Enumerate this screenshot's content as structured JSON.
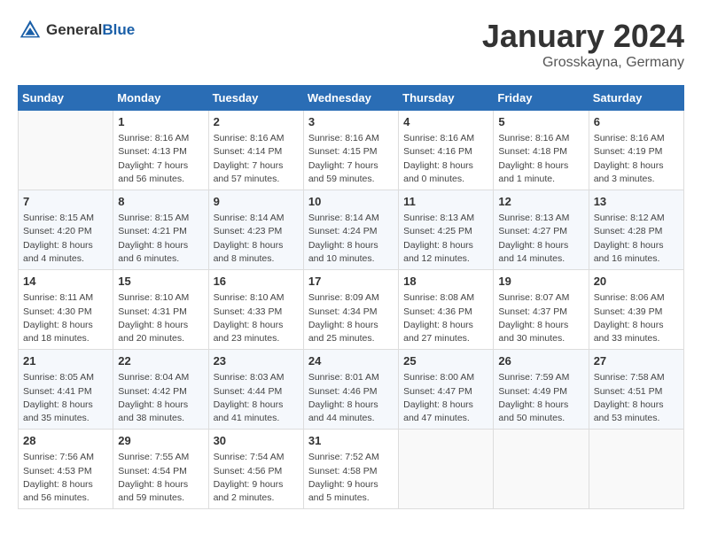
{
  "header": {
    "logo_general": "General",
    "logo_blue": "Blue",
    "month": "January 2024",
    "location": "Grosskayna, Germany"
  },
  "weekdays": [
    "Sunday",
    "Monday",
    "Tuesday",
    "Wednesday",
    "Thursday",
    "Friday",
    "Saturday"
  ],
  "weeks": [
    [
      {
        "day": "",
        "info": ""
      },
      {
        "day": "1",
        "info": "Sunrise: 8:16 AM\nSunset: 4:13 PM\nDaylight: 7 hours\nand 56 minutes."
      },
      {
        "day": "2",
        "info": "Sunrise: 8:16 AM\nSunset: 4:14 PM\nDaylight: 7 hours\nand 57 minutes."
      },
      {
        "day": "3",
        "info": "Sunrise: 8:16 AM\nSunset: 4:15 PM\nDaylight: 7 hours\nand 59 minutes."
      },
      {
        "day": "4",
        "info": "Sunrise: 8:16 AM\nSunset: 4:16 PM\nDaylight: 8 hours\nand 0 minutes."
      },
      {
        "day": "5",
        "info": "Sunrise: 8:16 AM\nSunset: 4:18 PM\nDaylight: 8 hours\nand 1 minute."
      },
      {
        "day": "6",
        "info": "Sunrise: 8:16 AM\nSunset: 4:19 PM\nDaylight: 8 hours\nand 3 minutes."
      }
    ],
    [
      {
        "day": "7",
        "info": "Sunrise: 8:15 AM\nSunset: 4:20 PM\nDaylight: 8 hours\nand 4 minutes."
      },
      {
        "day": "8",
        "info": "Sunrise: 8:15 AM\nSunset: 4:21 PM\nDaylight: 8 hours\nand 6 minutes."
      },
      {
        "day": "9",
        "info": "Sunrise: 8:14 AM\nSunset: 4:23 PM\nDaylight: 8 hours\nand 8 minutes."
      },
      {
        "day": "10",
        "info": "Sunrise: 8:14 AM\nSunset: 4:24 PM\nDaylight: 8 hours\nand 10 minutes."
      },
      {
        "day": "11",
        "info": "Sunrise: 8:13 AM\nSunset: 4:25 PM\nDaylight: 8 hours\nand 12 minutes."
      },
      {
        "day": "12",
        "info": "Sunrise: 8:13 AM\nSunset: 4:27 PM\nDaylight: 8 hours\nand 14 minutes."
      },
      {
        "day": "13",
        "info": "Sunrise: 8:12 AM\nSunset: 4:28 PM\nDaylight: 8 hours\nand 16 minutes."
      }
    ],
    [
      {
        "day": "14",
        "info": "Sunrise: 8:11 AM\nSunset: 4:30 PM\nDaylight: 8 hours\nand 18 minutes."
      },
      {
        "day": "15",
        "info": "Sunrise: 8:10 AM\nSunset: 4:31 PM\nDaylight: 8 hours\nand 20 minutes."
      },
      {
        "day": "16",
        "info": "Sunrise: 8:10 AM\nSunset: 4:33 PM\nDaylight: 8 hours\nand 23 minutes."
      },
      {
        "day": "17",
        "info": "Sunrise: 8:09 AM\nSunset: 4:34 PM\nDaylight: 8 hours\nand 25 minutes."
      },
      {
        "day": "18",
        "info": "Sunrise: 8:08 AM\nSunset: 4:36 PM\nDaylight: 8 hours\nand 27 minutes."
      },
      {
        "day": "19",
        "info": "Sunrise: 8:07 AM\nSunset: 4:37 PM\nDaylight: 8 hours\nand 30 minutes."
      },
      {
        "day": "20",
        "info": "Sunrise: 8:06 AM\nSunset: 4:39 PM\nDaylight: 8 hours\nand 33 minutes."
      }
    ],
    [
      {
        "day": "21",
        "info": "Sunrise: 8:05 AM\nSunset: 4:41 PM\nDaylight: 8 hours\nand 35 minutes."
      },
      {
        "day": "22",
        "info": "Sunrise: 8:04 AM\nSunset: 4:42 PM\nDaylight: 8 hours\nand 38 minutes."
      },
      {
        "day": "23",
        "info": "Sunrise: 8:03 AM\nSunset: 4:44 PM\nDaylight: 8 hours\nand 41 minutes."
      },
      {
        "day": "24",
        "info": "Sunrise: 8:01 AM\nSunset: 4:46 PM\nDaylight: 8 hours\nand 44 minutes."
      },
      {
        "day": "25",
        "info": "Sunrise: 8:00 AM\nSunset: 4:47 PM\nDaylight: 8 hours\nand 47 minutes."
      },
      {
        "day": "26",
        "info": "Sunrise: 7:59 AM\nSunset: 4:49 PM\nDaylight: 8 hours\nand 50 minutes."
      },
      {
        "day": "27",
        "info": "Sunrise: 7:58 AM\nSunset: 4:51 PM\nDaylight: 8 hours\nand 53 minutes."
      }
    ],
    [
      {
        "day": "28",
        "info": "Sunrise: 7:56 AM\nSunset: 4:53 PM\nDaylight: 8 hours\nand 56 minutes."
      },
      {
        "day": "29",
        "info": "Sunrise: 7:55 AM\nSunset: 4:54 PM\nDaylight: 8 hours\nand 59 minutes."
      },
      {
        "day": "30",
        "info": "Sunrise: 7:54 AM\nSunset: 4:56 PM\nDaylight: 9 hours\nand 2 minutes."
      },
      {
        "day": "31",
        "info": "Sunrise: 7:52 AM\nSunset: 4:58 PM\nDaylight: 9 hours\nand 5 minutes."
      },
      {
        "day": "",
        "info": ""
      },
      {
        "day": "",
        "info": ""
      },
      {
        "day": "",
        "info": ""
      }
    ]
  ]
}
